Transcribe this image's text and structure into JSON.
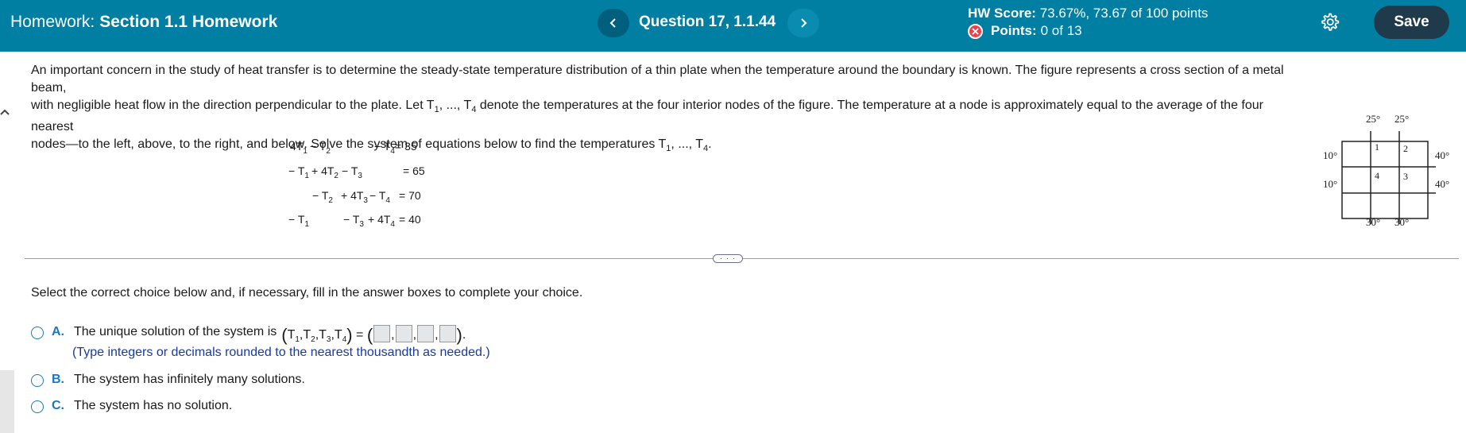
{
  "header": {
    "homework_prefix": "Homework:",
    "homework_name": "Section 1.1 Homework",
    "question_label": "Question 17, 1.1.44",
    "hw_score_label": "HW Score:",
    "hw_score_value": "73.67%, 73.67 of 100 points",
    "points_label": "Points:",
    "points_value": "0 of 13",
    "save_label": "Save",
    "background_color": "#007fa3",
    "icons": [
      "chevron-left-icon",
      "chevron-right-icon",
      "x-circle-icon",
      "gear-icon"
    ]
  },
  "problem": {
    "line1": "An important concern in the study of heat transfer is to determine the steady-state temperature distribution of a thin plate when the temperature around the boundary is known. The figure represents a cross section of a metal beam,",
    "line2_pre": "with negligible heat flow in the direction perpendicular to the plate. Let T",
    "line2_mid": ", ..., T",
    "line2_post": " denote the temperatures at the four interior nodes of the figure. The temperature at a node is approximately equal to the average of the four nearest",
    "line3_pre": "nodes—to the left, above, to the right, and below. Solve the system of equations below to find the temperatures T",
    "line3_mid": ", ..., T",
    "line3_post": ".",
    "sub_1": "1",
    "sub_4": "4"
  },
  "equations": {
    "eq1": {
      "a": "4T",
      "a_sub": "1",
      "b": " − T",
      "b_sub": "2",
      "c": "−  T",
      "c_sub": "4",
      "rhs": " = 35"
    },
    "eq2": {
      "a": "− T",
      "a_sub": "1",
      "b": " + 4T",
      "b_sub": "2",
      "c": " − T",
      "c_sub": "3",
      "rhs": "= 65"
    },
    "eq3": {
      "a": "− T",
      "a_sub": "2",
      "b": " + 4T",
      "b_sub": "3",
      "c": " −  T",
      "c_sub": "4",
      "rhs": " = 70"
    },
    "eq4": {
      "a": "− T",
      "a_sub": "1",
      "b": "− T",
      "b_sub": "3",
      "c": " + 4T",
      "c_sub": "4",
      "rhs": " = 40"
    }
  },
  "figure": {
    "top": [
      "25°",
      "25°"
    ],
    "left": [
      "10°",
      "10°"
    ],
    "right": [
      "40°",
      "40°"
    ],
    "bottom": [
      "30°",
      "30°"
    ],
    "nodes": [
      "1",
      "2",
      "3",
      "4"
    ]
  },
  "more_label": "· · ·",
  "instructions": "Select the correct choice below and, if necessary, fill in the answer boxes to complete your choice.",
  "choices": {
    "a_letter": "A.",
    "a_text": "The unique solution of the system is",
    "a_hint": "(Type integers or decimals rounded to the nearest thousandth as needed.)",
    "a_tuple_equals": " = ",
    "b_letter": "B.",
    "b_text": "The system has infinitely many solutions.",
    "c_letter": "C.",
    "c_text": "The system has no solution."
  }
}
